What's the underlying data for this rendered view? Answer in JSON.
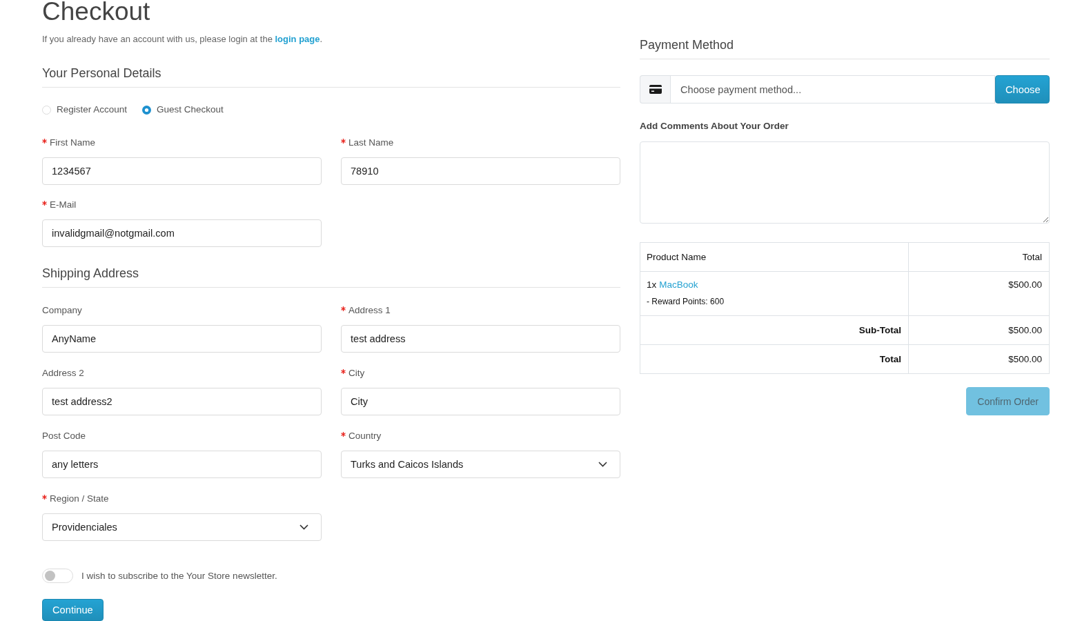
{
  "page_title": "Checkout",
  "login_notice": {
    "text": "If you already have an account with us, please login at the ",
    "link": "login page",
    "end": "."
  },
  "personal_details": {
    "heading": "Your Personal Details",
    "account_options": [
      {
        "label": "Register Account",
        "selected": false
      },
      {
        "label": "Guest Checkout",
        "selected": true
      }
    ],
    "rows": [
      [
        {
          "label": "First Name",
          "required": true,
          "kind": "text",
          "value": "1234567"
        },
        {
          "label": "Last Name",
          "required": true,
          "kind": "text",
          "value": "78910"
        }
      ],
      [
        {
          "label": "E-Mail",
          "required": true,
          "kind": "text",
          "value": "invalidgmail@notgmail.com"
        }
      ]
    ]
  },
  "shipping_address": {
    "heading": "Shipping Address",
    "rows": [
      [
        {
          "label": "Company",
          "required": false,
          "kind": "text",
          "value": "AnyName"
        },
        {
          "label": "Address 1",
          "required": true,
          "kind": "text",
          "value": "test address"
        }
      ],
      [
        {
          "label": "Address 2",
          "required": false,
          "kind": "text",
          "value": "test address2"
        },
        {
          "label": "City",
          "required": true,
          "kind": "text",
          "value": "City"
        }
      ],
      [
        {
          "label": "Post Code",
          "required": false,
          "kind": "text",
          "value": "any letters"
        },
        {
          "label": "Country",
          "required": true,
          "kind": "select",
          "value": "Turks and Caicos Islands"
        }
      ],
      [
        {
          "label": "Region / State",
          "required": true,
          "kind": "select",
          "value": "Providenciales"
        }
      ]
    ]
  },
  "newsletter": {
    "label": "I wish to subscribe to the Your Store newsletter.",
    "on": false
  },
  "continue_button": "Continue",
  "payment_method": {
    "heading": "Payment Method",
    "placeholder": "Choose payment method...",
    "button": "Choose"
  },
  "comments": {
    "label": "Add Comments About Your Order"
  },
  "order_summary": {
    "columns": [
      "Product Name",
      "Total"
    ],
    "items": [
      {
        "quantity": "1x",
        "name": "MacBook",
        "reward": "- Reward Points: 600",
        "total": "$500.00"
      }
    ],
    "totals": [
      {
        "label": "Sub-Total",
        "value": "$500.00"
      },
      {
        "label": "Total",
        "value": "$500.00"
      }
    ]
  },
  "confirm_button": {
    "label": "Confirm Order",
    "disabled": true
  }
}
